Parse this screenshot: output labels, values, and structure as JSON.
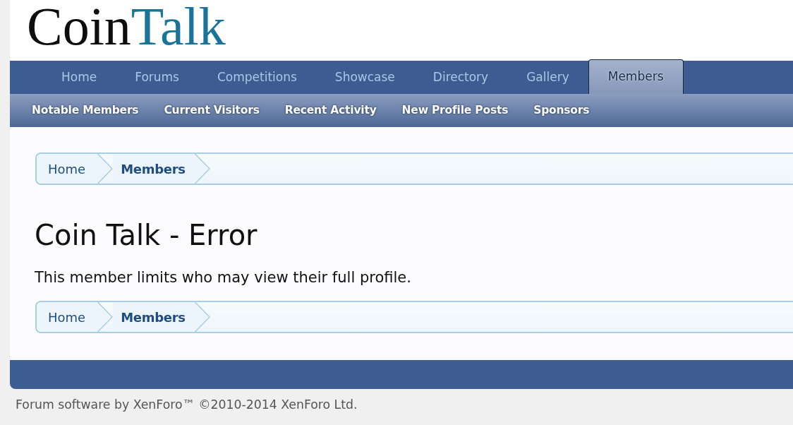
{
  "logo": {
    "first": "Coin",
    "second": "Talk"
  },
  "nav_tabs": [
    {
      "label": "Home",
      "selected": false
    },
    {
      "label": "Forums",
      "selected": false
    },
    {
      "label": "Competitions",
      "selected": false
    },
    {
      "label": "Showcase",
      "selected": false
    },
    {
      "label": "Directory",
      "selected": false
    },
    {
      "label": "Gallery",
      "selected": false
    },
    {
      "label": "Members",
      "selected": true
    }
  ],
  "sub_nav": [
    "Notable Members",
    "Current Visitors",
    "Recent Activity",
    "New Profile Posts",
    "Sponsors"
  ],
  "breadcrumb_top": [
    {
      "label": "Home",
      "current": false
    },
    {
      "label": "Members",
      "current": true
    }
  ],
  "page_title": "Coin Talk - Error",
  "message": "This member limits who may view their full profile.",
  "breadcrumb_bottom": [
    {
      "label": "Home",
      "current": false
    },
    {
      "label": "Members",
      "current": true
    }
  ],
  "footer": "Forum software by XenForo™ ©2010-2014 XenForo Ltd."
}
